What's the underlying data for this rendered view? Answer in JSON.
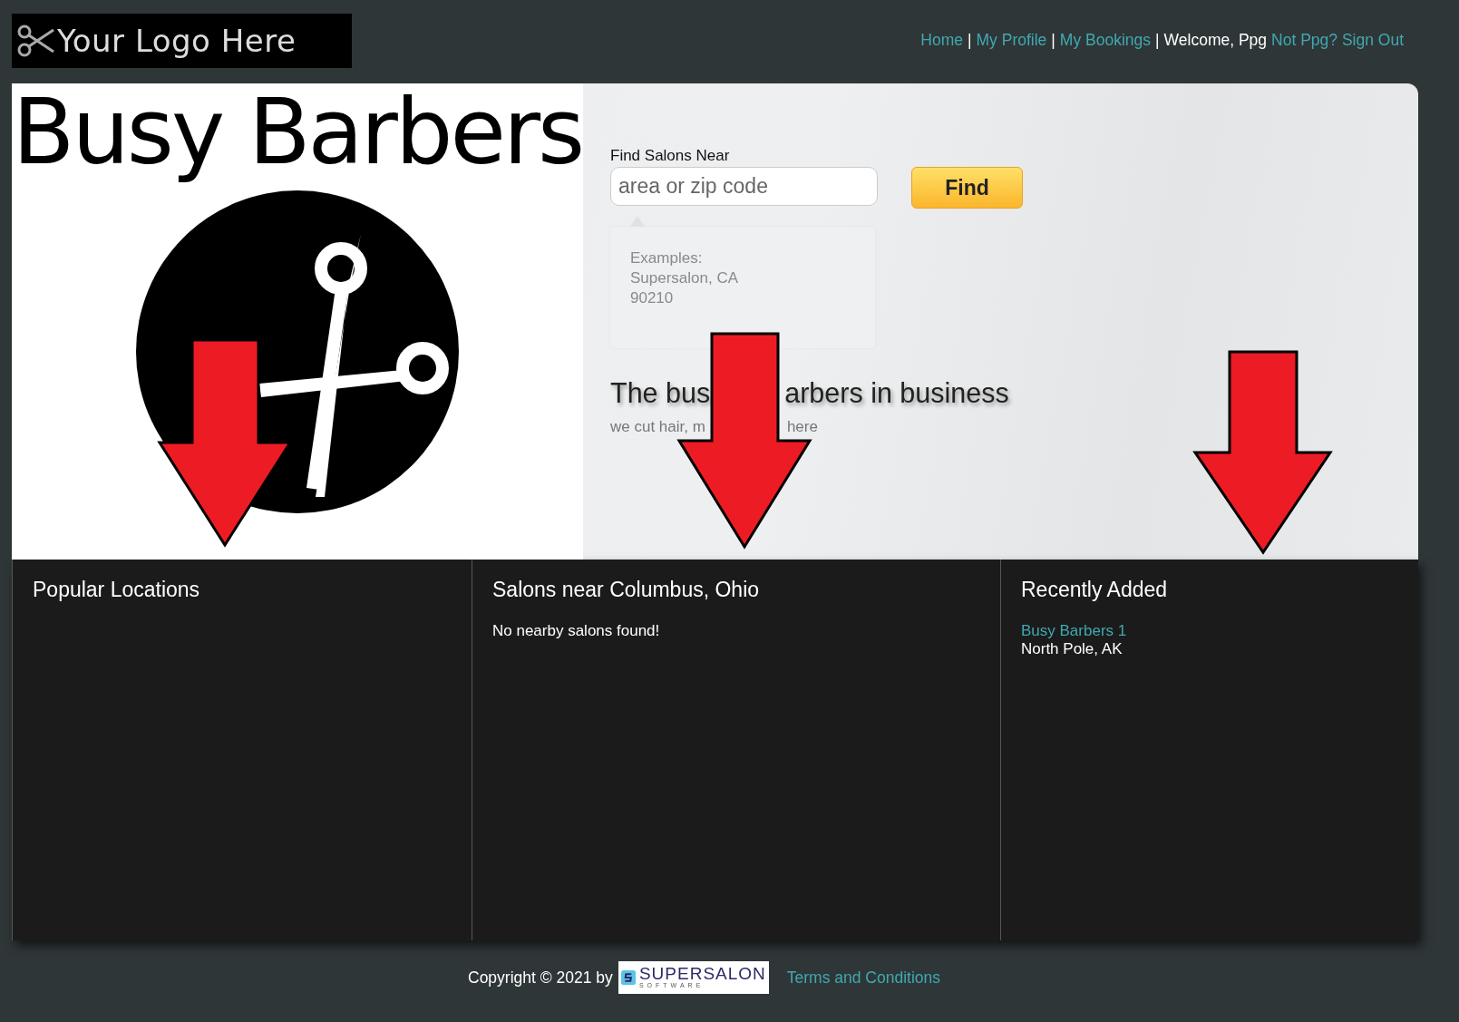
{
  "header": {
    "logo": {
      "text": "Your Logo Here"
    },
    "nav": [
      {
        "text": "Home",
        "kind": "link"
      },
      {
        "text": "|",
        "kind": "separator"
      },
      {
        "text": "My Profile",
        "kind": "link"
      },
      {
        "text": "|",
        "kind": "separator"
      },
      {
        "text": "My Bookings",
        "kind": "link"
      },
      {
        "text": "|",
        "kind": "separator"
      },
      {
        "text": "Welcome, Ppg",
        "kind": "text"
      },
      {
        "text": "Not Ppg? Sign Out",
        "kind": "link"
      }
    ]
  },
  "hero": {
    "brand": "Busy Barbers",
    "search": {
      "label": "Find Salons Near",
      "placeholder": "area or zip code",
      "button": "Find"
    },
    "hint": [
      "Examples:",
      "Supersalon, CA",
      "90210"
    ],
    "tagline_parts": [
      "The bus",
      "arbers in business"
    ],
    "subtitle_parts": [
      "we cut hair, m",
      "here"
    ]
  },
  "columns": [
    {
      "title": "Popular Locations"
    },
    {
      "title": "Salons near Columbus, Ohio",
      "items": [
        {
          "kind": "message",
          "text": "No nearby salons found!"
        }
      ]
    },
    {
      "title": "Recently Added",
      "items": [
        {
          "kind": "salon",
          "name": "Busy Barbers 1",
          "place": "North Pole, AK"
        }
      ]
    }
  ],
  "footer": {
    "copyright": "Copyright © 2021 by",
    "partner_logo": {
      "name": "SUPERSALON",
      "sub": "SOFTWARE"
    },
    "terms": "Terms and Conditions"
  }
}
